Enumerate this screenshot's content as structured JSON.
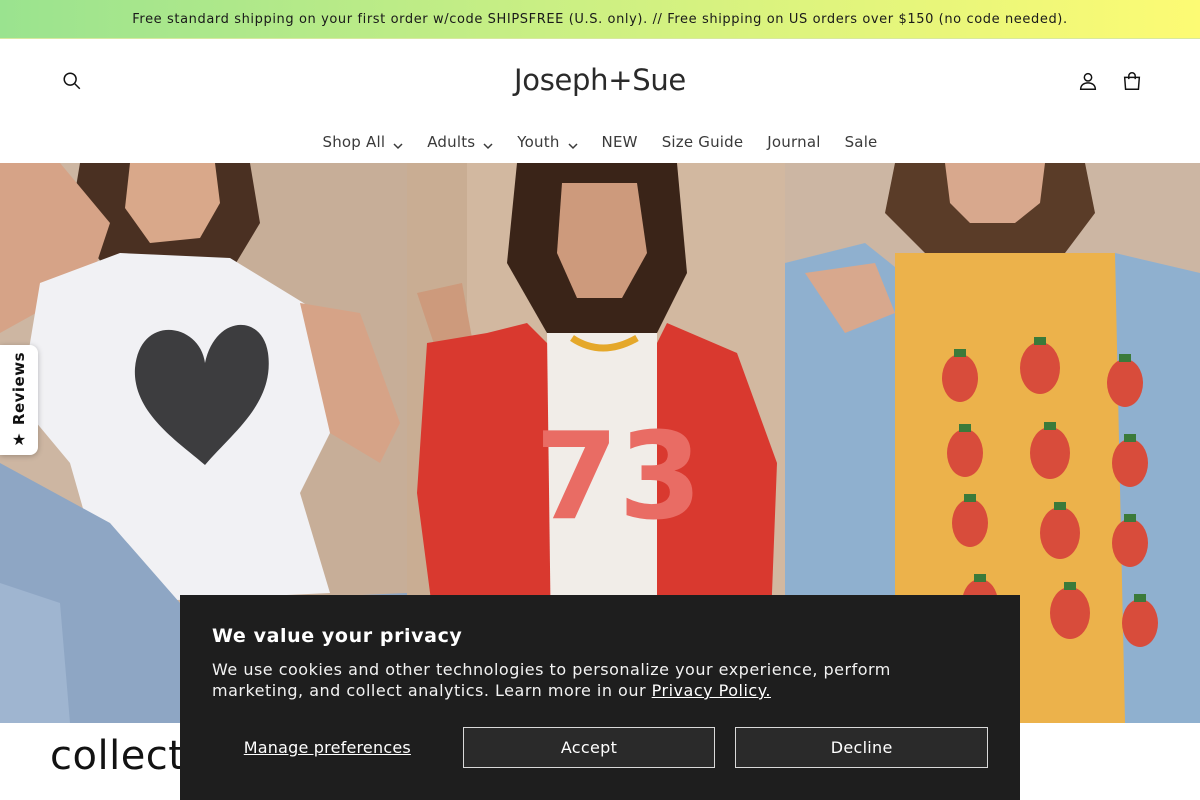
{
  "announcement": {
    "text": "Free standard shipping on your first order w/code SHIPSFREE (U.S. only). // Free shipping on US orders over $150 (no code needed).",
    "gradient_start": "#9ae38f",
    "gradient_end": "#fdfb74"
  },
  "header": {
    "logo": "Joseph+Sue",
    "icons": {
      "search": "search-icon",
      "account": "account-icon",
      "cart": "cart-icon"
    }
  },
  "nav": {
    "items": [
      {
        "label": "Shop All",
        "has_dropdown": true
      },
      {
        "label": "Adults",
        "has_dropdown": true
      },
      {
        "label": "Youth",
        "has_dropdown": true
      },
      {
        "label": "NEW",
        "has_dropdown": false
      },
      {
        "label": "Size Guide",
        "has_dropdown": false
      },
      {
        "label": "Journal",
        "has_dropdown": false
      },
      {
        "label": "Sale",
        "has_dropdown": false
      }
    ]
  },
  "hero": {
    "panels": [
      "heart-tee-photo",
      "number-73-tee-photo",
      "strawberry-tee-photo"
    ]
  },
  "reviews_tab": {
    "label": "Reviews",
    "icon": "star-icon"
  },
  "collection": {
    "title": "collecti"
  },
  "cookie_banner": {
    "title": "We value your privacy",
    "body": "We use cookies and other technologies to personalize your experience, perform marketing, and collect analytics. Learn more in our ",
    "link_text": "Privacy Policy.",
    "manage_label": "Manage preferences",
    "accept_label": "Accept",
    "decline_label": "Decline",
    "background": "#1e1e1e"
  }
}
